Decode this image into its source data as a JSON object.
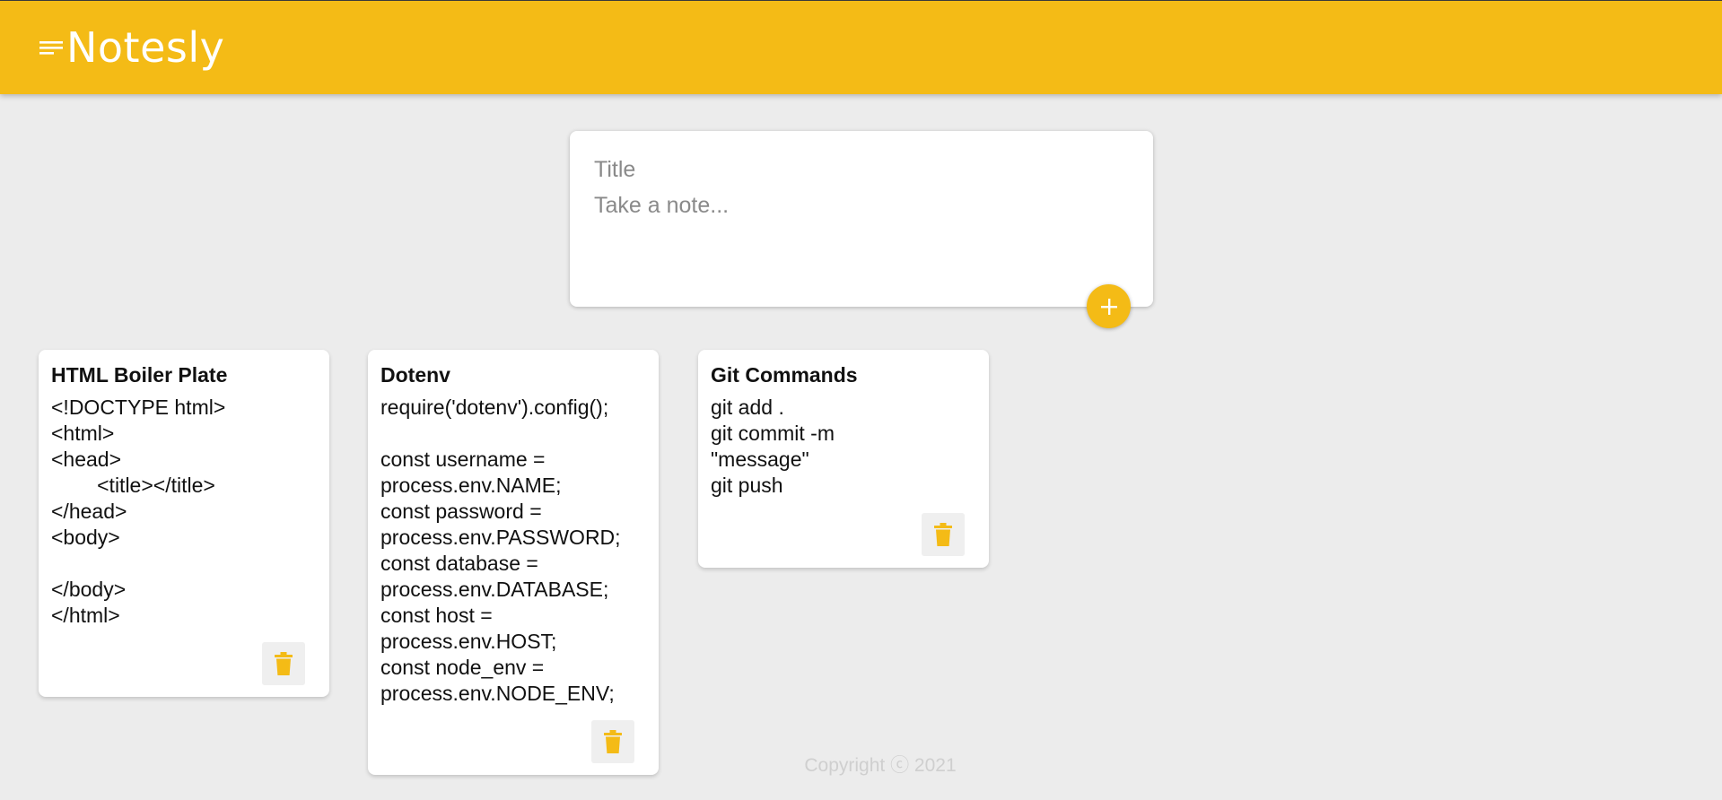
{
  "header": {
    "app_name": "Notesly",
    "menu_icon": "notes-lines-icon",
    "background_color": "#f4bb16"
  },
  "composer": {
    "title_placeholder": "Title",
    "content_placeholder": "Take a note...",
    "add_icon": "plus-icon"
  },
  "notes": [
    {
      "title": "HTML Boiler Plate",
      "content": "<!DOCTYPE html>\n<html>\n<head>\n        <title></title>\n</head>\n<body>\n\n</body>\n</html>",
      "delete_icon": "trash-icon"
    },
    {
      "title": "Dotenv",
      "content": "require('dotenv').config();\n\nconst username =\nprocess.env.NAME;\nconst password =\nprocess.env.PASSWORD;\nconst database =\nprocess.env.DATABASE;\nconst host =\nprocess.env.HOST;\nconst node_env =\nprocess.env.NODE_ENV;",
      "delete_icon": "trash-icon"
    },
    {
      "title": "Git Commands",
      "content": "git add .\ngit commit -m\n\"message\"\ngit push",
      "delete_icon": "trash-icon"
    }
  ],
  "footer": {
    "copyright": "Copyright ⓒ 2021"
  },
  "colors": {
    "accent": "#f4bb16",
    "background": "#ececec",
    "footer_text": "#cfcfcf"
  }
}
